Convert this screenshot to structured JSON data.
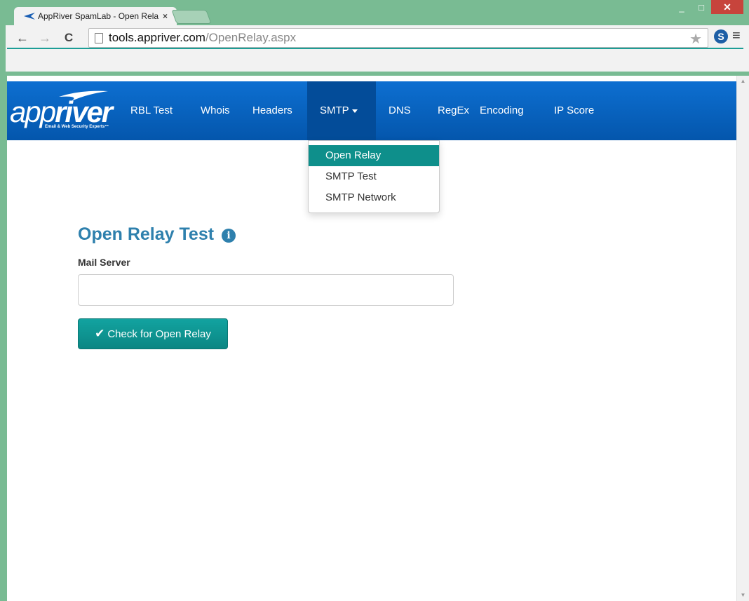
{
  "window": {
    "minimize": "_",
    "maximize": "□",
    "close": "✕"
  },
  "browser": {
    "tab_title": "AppRiver SpamLab - Open Relay",
    "tab_close": "×",
    "url_host": "tools.appriver.com",
    "url_path": "/OpenRelay.aspx",
    "back": "←",
    "forward": "→",
    "reload": "C",
    "star": "★",
    "extension": "S",
    "menu": "≡"
  },
  "brand": {
    "name_light": "app",
    "name_bold": "river",
    "tagline": "Email & Web Security Experts™"
  },
  "navbar": {
    "items": [
      {
        "label": "RBL Test"
      },
      {
        "label": "Whois"
      },
      {
        "label": "Headers"
      },
      {
        "label": "SMTP"
      },
      {
        "label": "DNS"
      },
      {
        "label": "RegEx"
      },
      {
        "label": "Encoding"
      },
      {
        "label": "IP Score"
      }
    ]
  },
  "dropdown": {
    "items": [
      {
        "label": "Open Relay",
        "active": true
      },
      {
        "label": "SMTP Test"
      },
      {
        "label": "SMTP Network"
      }
    ]
  },
  "main": {
    "title": "Open Relay Test",
    "info_icon": "i",
    "field_label": "Mail Server",
    "field_value": "",
    "submit_label": "Check for Open Relay",
    "check_glyph": "✔"
  },
  "colors": {
    "accent": "#0e8f8b",
    "nav": "#0a63c0",
    "title": "#2e80ad",
    "chrome": "#79bb93"
  }
}
